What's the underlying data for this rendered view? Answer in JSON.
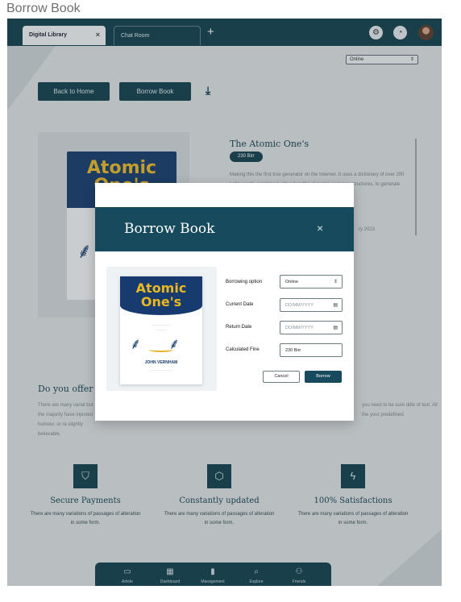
{
  "frame_title": "Borrow Book",
  "browser": {
    "tabs": [
      {
        "label": "Digital Library",
        "active": true,
        "close": "×"
      },
      {
        "label": "Chat Room",
        "active": false
      }
    ],
    "add_tab": "+",
    "icons": [
      "settings-icon",
      "notification-icon",
      "avatar"
    ]
  },
  "page": {
    "back_label": "Back to Home",
    "borrow_label": "Borrow Book",
    "download_icon": "⤓",
    "top_select": {
      "value": "Online",
      "chev": "⇕"
    },
    "cover": {
      "title_line1": "Atomic",
      "title_line2": "One's"
    },
    "book": {
      "title": "The Atomic One's",
      "price": "230 Birr",
      "description": "Making this the first true generator on the Internet. It uses a dictionary of over 200 Latin words, combined with a handful of model sentence structures, to generate Lorem Ipsum which looks reasonable. The"
    },
    "date_fragment": "ry 2023",
    "section_heading": "Do you offer c",
    "para_left": "There are many variat but the majority have injected humour, or ra slightly believable.",
    "para_right": "you need to be sure ddle of text. All the your predefined"
  },
  "features": [
    {
      "icon": "shield-icon",
      "glyph": "⛉",
      "title": "Secure Payments",
      "text": "There are many variations of passages of alteration in some form."
    },
    {
      "icon": "cube-icon",
      "glyph": "⬡",
      "title": "Constantly updated",
      "text": "There are many variations of passages of alteration in some form."
    },
    {
      "icon": "lightning-icon",
      "glyph": "ϟ",
      "title": "100% Satisfactions",
      "text": "There are many variations of passages of alteration in some form."
    }
  ],
  "bottom_nav": [
    {
      "label": "Article",
      "icon": "article-icon",
      "glyph": "▭"
    },
    {
      "label": "Dashboard",
      "icon": "dashboard-icon",
      "glyph": "▦"
    },
    {
      "label": "Management",
      "icon": "management-icon",
      "glyph": "▮"
    },
    {
      "label": "Explore",
      "icon": "search-icon",
      "glyph": "⌕"
    },
    {
      "label": "Friends",
      "icon": "friends-icon",
      "glyph": "⚇"
    }
  ],
  "modal": {
    "title": "Borrow Book",
    "close": "×",
    "cover": {
      "title_line1": "Atomic",
      "title_line2": "One's",
      "author": "JOHN VERNHAM"
    },
    "fields": {
      "borrowing_option": {
        "label": "Borrowing option",
        "value": "Online",
        "chev": "⇕"
      },
      "current_date": {
        "label": "Current Date",
        "placeholder": "DD/MM/YYYY",
        "icon": "▤"
      },
      "return_date": {
        "label": "Return Date",
        "placeholder": "DD/MM/YYYY",
        "icon": "▤"
      },
      "calculated_fine": {
        "label": "Calculated Fine",
        "value": "230 Birr"
      }
    },
    "cancel_label": "Cancel",
    "borrow_label": "Borrow"
  },
  "colors": {
    "primary": "#123f4e",
    "modal_header": "#164a5c",
    "cover_blue": "#173b6e",
    "cover_yellow": "#eab922"
  }
}
